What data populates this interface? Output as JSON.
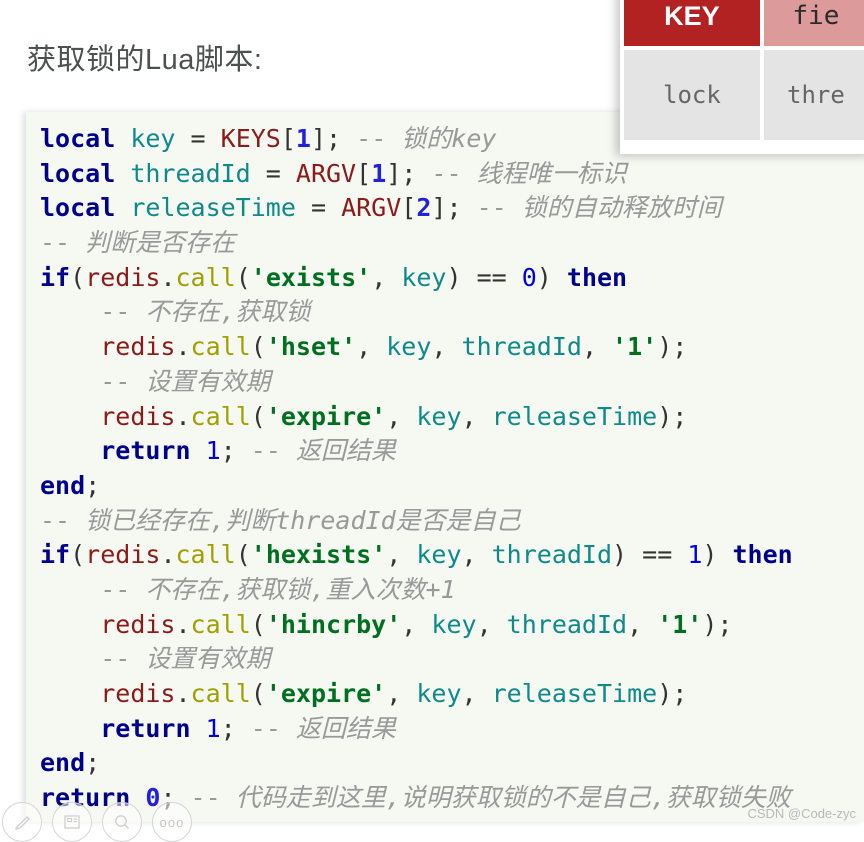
{
  "slide": {
    "title": "获取锁的Lua脚本:"
  },
  "code": {
    "language": "lua",
    "background_color": "#f6f8f2",
    "token_colors": {
      "keyword": "#00008b",
      "variable": "#0e8a8a",
      "global": "#8b1a1a",
      "function": "#a0a000",
      "string": "#007020",
      "number": "#2020dd",
      "comment": "#999999"
    },
    "lines": [
      {
        "indent": 0,
        "tokens": [
          {
            "t": "local",
            "c": "kw"
          },
          {
            "t": " ",
            "c": "punc"
          },
          {
            "t": "key",
            "c": "var"
          },
          {
            "t": " = ",
            "c": "punc"
          },
          {
            "t": "KEYS",
            "c": "glob"
          },
          {
            "t": "[",
            "c": "punc"
          },
          {
            "t": "1",
            "c": "num"
          },
          {
            "t": "]; ",
            "c": "punc"
          },
          {
            "t": "-- ",
            "c": "cmtd"
          },
          {
            "t": "锁的key",
            "c": "cmt"
          }
        ]
      },
      {
        "indent": 0,
        "tokens": [
          {
            "t": "local",
            "c": "kw"
          },
          {
            "t": " ",
            "c": "punc"
          },
          {
            "t": "threadId",
            "c": "var"
          },
          {
            "t": " = ",
            "c": "punc"
          },
          {
            "t": "ARGV",
            "c": "glob"
          },
          {
            "t": "[",
            "c": "punc"
          },
          {
            "t": "1",
            "c": "num"
          },
          {
            "t": "]; ",
            "c": "punc"
          },
          {
            "t": "-- ",
            "c": "cmtd"
          },
          {
            "t": "线程唯一标识",
            "c": "cmt"
          }
        ]
      },
      {
        "indent": 0,
        "tokens": [
          {
            "t": "local",
            "c": "kw"
          },
          {
            "t": " ",
            "c": "punc"
          },
          {
            "t": "releaseTime",
            "c": "var"
          },
          {
            "t": " = ",
            "c": "punc"
          },
          {
            "t": "ARGV",
            "c": "glob"
          },
          {
            "t": "[",
            "c": "punc"
          },
          {
            "t": "2",
            "c": "num"
          },
          {
            "t": "]; ",
            "c": "punc"
          },
          {
            "t": "-- ",
            "c": "cmtd"
          },
          {
            "t": "锁的自动释放时间",
            "c": "cmt"
          }
        ]
      },
      {
        "indent": 0,
        "tokens": [
          {
            "t": "-- ",
            "c": "cmtd"
          },
          {
            "t": "判断是否存在",
            "c": "cmt"
          }
        ]
      },
      {
        "indent": 0,
        "tokens": [
          {
            "t": "if",
            "c": "kw"
          },
          {
            "t": "(",
            "c": "punc"
          },
          {
            "t": "redis",
            "c": "glob"
          },
          {
            "t": ".",
            "c": "punc"
          },
          {
            "t": "call",
            "c": "fn"
          },
          {
            "t": "(",
            "c": "punc"
          },
          {
            "t": "'exists'",
            "c": "str"
          },
          {
            "t": ", ",
            "c": "punc"
          },
          {
            "t": "key",
            "c": "var"
          },
          {
            "t": ") == ",
            "c": "punc"
          },
          {
            "t": "0",
            "c": "num2"
          },
          {
            "t": ") ",
            "c": "punc"
          },
          {
            "t": "then",
            "c": "kw"
          }
        ]
      },
      {
        "indent": 4,
        "tokens": [
          {
            "t": "-- ",
            "c": "cmtd"
          },
          {
            "t": "不存在,获取锁",
            "c": "cmt"
          }
        ]
      },
      {
        "indent": 4,
        "tokens": [
          {
            "t": "redis",
            "c": "glob"
          },
          {
            "t": ".",
            "c": "punc"
          },
          {
            "t": "call",
            "c": "fn"
          },
          {
            "t": "(",
            "c": "punc"
          },
          {
            "t": "'hset'",
            "c": "str"
          },
          {
            "t": ", ",
            "c": "punc"
          },
          {
            "t": "key",
            "c": "var"
          },
          {
            "t": ", ",
            "c": "punc"
          },
          {
            "t": "threadId",
            "c": "var"
          },
          {
            "t": ", ",
            "c": "punc"
          },
          {
            "t": "'1'",
            "c": "str"
          },
          {
            "t": ");",
            "c": "punc"
          }
        ]
      },
      {
        "indent": 4,
        "tokens": [
          {
            "t": "-- ",
            "c": "cmtd"
          },
          {
            "t": "设置有效期",
            "c": "cmt"
          }
        ]
      },
      {
        "indent": 4,
        "tokens": [
          {
            "t": "redis",
            "c": "glob"
          },
          {
            "t": ".",
            "c": "punc"
          },
          {
            "t": "call",
            "c": "fn"
          },
          {
            "t": "(",
            "c": "punc"
          },
          {
            "t": "'expire'",
            "c": "str"
          },
          {
            "t": ", ",
            "c": "punc"
          },
          {
            "t": "key",
            "c": "var"
          },
          {
            "t": ", ",
            "c": "punc"
          },
          {
            "t": "releaseTime",
            "c": "var"
          },
          {
            "t": ");",
            "c": "punc"
          }
        ]
      },
      {
        "indent": 4,
        "tokens": [
          {
            "t": "return",
            "c": "kw"
          },
          {
            "t": " ",
            "c": "punc"
          },
          {
            "t": "1",
            "c": "num2"
          },
          {
            "t": "; ",
            "c": "punc"
          },
          {
            "t": "-- ",
            "c": "cmtd"
          },
          {
            "t": "返回结果",
            "c": "cmt"
          }
        ]
      },
      {
        "indent": 0,
        "tokens": [
          {
            "t": "end",
            "c": "kw"
          },
          {
            "t": ";",
            "c": "punc"
          }
        ]
      },
      {
        "indent": 0,
        "tokens": [
          {
            "t": "-- ",
            "c": "cmtd"
          },
          {
            "t": "锁已经存在,判断threadId是否是自己",
            "c": "cmt"
          }
        ]
      },
      {
        "indent": 0,
        "tokens": [
          {
            "t": "if",
            "c": "kw"
          },
          {
            "t": "(",
            "c": "punc"
          },
          {
            "t": "redis",
            "c": "glob"
          },
          {
            "t": ".",
            "c": "punc"
          },
          {
            "t": "call",
            "c": "fn"
          },
          {
            "t": "(",
            "c": "punc"
          },
          {
            "t": "'hexists'",
            "c": "str"
          },
          {
            "t": ", ",
            "c": "punc"
          },
          {
            "t": "key",
            "c": "var"
          },
          {
            "t": ", ",
            "c": "punc"
          },
          {
            "t": "threadId",
            "c": "var"
          },
          {
            "t": ") == ",
            "c": "punc"
          },
          {
            "t": "1",
            "c": "num2"
          },
          {
            "t": ") ",
            "c": "punc"
          },
          {
            "t": "then",
            "c": "kw"
          }
        ]
      },
      {
        "indent": 4,
        "tokens": [
          {
            "t": "-- ",
            "c": "cmtd"
          },
          {
            "t": "不存在,获取锁,重入次数+1",
            "c": "cmt"
          }
        ]
      },
      {
        "indent": 4,
        "tokens": [
          {
            "t": "redis",
            "c": "glob"
          },
          {
            "t": ".",
            "c": "punc"
          },
          {
            "t": "call",
            "c": "fn"
          },
          {
            "t": "(",
            "c": "punc"
          },
          {
            "t": "'hincrby'",
            "c": "str"
          },
          {
            "t": ", ",
            "c": "punc"
          },
          {
            "t": "key",
            "c": "var"
          },
          {
            "t": ", ",
            "c": "punc"
          },
          {
            "t": "threadId",
            "c": "var"
          },
          {
            "t": ", ",
            "c": "punc"
          },
          {
            "t": "'1'",
            "c": "str"
          },
          {
            "t": ");",
            "c": "punc"
          }
        ]
      },
      {
        "indent": 4,
        "tokens": [
          {
            "t": "-- ",
            "c": "cmtd"
          },
          {
            "t": "设置有效期",
            "c": "cmt"
          }
        ]
      },
      {
        "indent": 4,
        "tokens": [
          {
            "t": "redis",
            "c": "glob"
          },
          {
            "t": ".",
            "c": "punc"
          },
          {
            "t": "call",
            "c": "fn"
          },
          {
            "t": "(",
            "c": "punc"
          },
          {
            "t": "'expire'",
            "c": "str"
          },
          {
            "t": ", ",
            "c": "punc"
          },
          {
            "t": "key",
            "c": "var"
          },
          {
            "t": ", ",
            "c": "punc"
          },
          {
            "t": "releaseTime",
            "c": "var"
          },
          {
            "t": ");",
            "c": "punc"
          }
        ]
      },
      {
        "indent": 4,
        "tokens": [
          {
            "t": "return",
            "c": "kw"
          },
          {
            "t": " ",
            "c": "punc"
          },
          {
            "t": "1",
            "c": "num2"
          },
          {
            "t": "; ",
            "c": "punc"
          },
          {
            "t": "-- ",
            "c": "cmtd"
          },
          {
            "t": "返回结果",
            "c": "cmt"
          }
        ]
      },
      {
        "indent": 0,
        "tokens": [
          {
            "t": "end",
            "c": "kw"
          },
          {
            "t": ";",
            "c": "punc"
          }
        ]
      },
      {
        "indent": 0,
        "tokens": [
          {
            "t": "return",
            "c": "kw"
          },
          {
            "t": " ",
            "c": "punc"
          },
          {
            "t": "0",
            "c": "num"
          },
          {
            "t": "; ",
            "c": "punc"
          },
          {
            "t": "-- ",
            "c": "cmtd"
          },
          {
            "t": "代码走到这里,说明获取锁的不是自己,获取锁失败",
            "c": "cmt"
          }
        ]
      }
    ]
  },
  "overlay_table": {
    "header": [
      {
        "label": "KEY",
        "color": "#b22222",
        "text_color": "#ffffff"
      },
      {
        "label": "fie",
        "color": "#dd9a9a",
        "text_color": "#2b2b2b"
      }
    ],
    "rows": [
      [
        "lock",
        "thre"
      ]
    ]
  },
  "toolbar": {
    "items": [
      {
        "name": "pen-icon",
        "glyph": "pen"
      },
      {
        "name": "layout-icon",
        "glyph": "layout"
      },
      {
        "name": "zoom-icon",
        "glyph": "magnifier"
      },
      {
        "name": "more-icon",
        "glyph": "ellipsis",
        "label": "ooo"
      }
    ]
  },
  "watermark": {
    "text": "CSDN @Code-zyc"
  }
}
